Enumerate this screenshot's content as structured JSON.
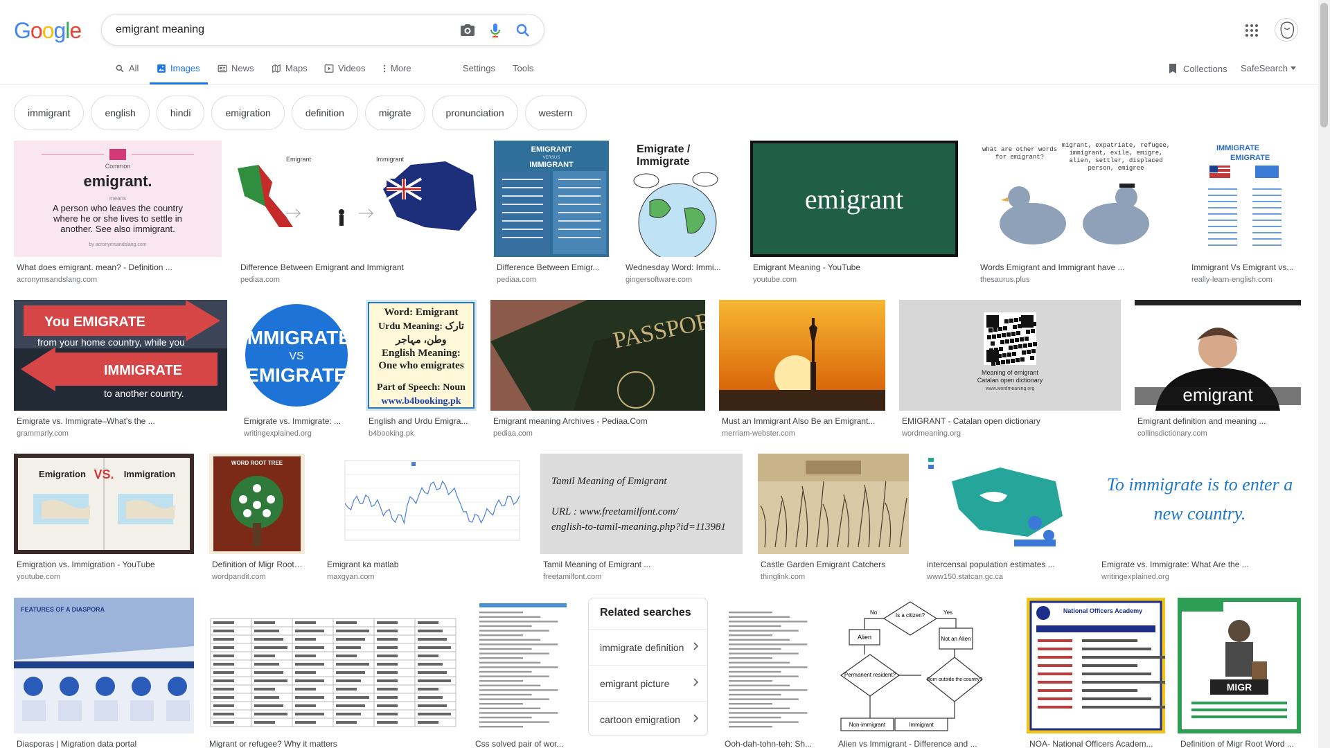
{
  "logo": {
    "letters": [
      "G",
      "o",
      "o",
      "g",
      "l",
      "e"
    ],
    "colors": [
      "#4285F4",
      "#EA4335",
      "#FBBC05",
      "#4285F4",
      "#34A853",
      "#EA4335"
    ]
  },
  "search": {
    "query": "emigrant meaning",
    "placeholder": ""
  },
  "tabs": [
    {
      "label": "All",
      "icon": "search-icon"
    },
    {
      "label": "Images",
      "icon": "image-icon"
    },
    {
      "label": "News",
      "icon": "news-icon"
    },
    {
      "label": "Maps",
      "icon": "map-icon"
    },
    {
      "label": "Videos",
      "icon": "video-icon"
    },
    {
      "label": "More",
      "icon": "more-vert-icon"
    },
    {
      "label": "Settings"
    },
    {
      "label": "Tools"
    }
  ],
  "header_right": {
    "collections": "Collections",
    "safesearch": "SafeSearch"
  },
  "chips": [
    "immigrant",
    "english",
    "hindi",
    "emigration",
    "definition",
    "migrate",
    "pronunciation",
    "western"
  ],
  "results": [
    {
      "title": "What does emigrant. mean? - Definition ...",
      "site": "acronymsandslang.com",
      "thumb": {
        "kind": "definition",
        "label_small": "Common",
        "word": "emigrant.",
        "label_sub": "means",
        "text": "A person who leaves the country where he or she lives to settle in another. See also immigrant.",
        "footer": "by acronymsandslang.com"
      }
    },
    {
      "title": "Difference Between Emigrant and Immigrant",
      "site": "pediaa.com",
      "thumb": {
        "kind": "italy",
        "left": "Emigrant",
        "right": "Immigrant"
      }
    },
    {
      "title": "Difference Between Emigr...",
      "site": "pediaa.com",
      "thumb": {
        "kind": "versus",
        "l1": "EMIGRANT",
        "l2": "VERSUS",
        "l3": "IMMIGRANT"
      }
    },
    {
      "title": "Wednesday Word: Immi...",
      "site": "gingersoftware.com",
      "thumb": {
        "kind": "globe",
        "text": "Emigrate / Immigrate"
      }
    },
    {
      "title": "Emigrant Meaning - YouTube",
      "site": "youtube.com",
      "thumb": {
        "kind": "chalk",
        "text": "emigrant"
      }
    },
    {
      "title": "Words Emigrant and Immigrant have ...",
      "site": "thesaurus.plus",
      "thumb": {
        "kind": "pigeons",
        "q": "what are other words for emigrant?",
        "words": "migrant, expatriate, refugee, immigrant, exile, emigre, alien, settler, displaced person, emigree"
      }
    },
    {
      "title": "Immigrant Vs Emigrant vs...",
      "site": "really-learn-english.com",
      "thumb": {
        "kind": "iv",
        "a": "IMMIGRATE",
        "b": "EMIGRATE"
      }
    },
    {
      "title": "Emigrate vs. Immigrate–What's the ...",
      "site": "grammarly.com",
      "thumb": {
        "kind": "arrows",
        "l1": "You EMIGRATE",
        "l2": "from your home country, while you",
        "l3": "IMMIGRATE",
        "l4": "to another country."
      }
    },
    {
      "title": "Emigrate vs. Immigrate: ...",
      "site": "writingexplained.org",
      "thumb": {
        "kind": "badge",
        "a": "IMMIGRATE",
        "vs": "VS",
        "b": "EMIGRATE"
      }
    },
    {
      "title": "English and Urdu Emigra...",
      "site": "b4booking.pk",
      "thumb": {
        "kind": "urdu",
        "l1": "Word: Emigrant",
        "l2": "Urdu Meaning: تارک",
        "l3": "وطن، مہاجر",
        "l4": "English Meaning: One who emigrates",
        "l5": "Part of Speech: Noun",
        "l6": "www.b4booking.pk"
      }
    },
    {
      "title": "Emigrant meaning Archives - Pediaa.Com",
      "site": "pediaa.com",
      "thumb": {
        "kind": "passport",
        "text": "PASSPORT"
      }
    },
    {
      "title": "Must an Immigrant Also Be an Emigrant...",
      "site": "merriam-webster.com",
      "thumb": {
        "kind": "liberty"
      }
    },
    {
      "title": "EMIGRANT - Catalan open dictionary",
      "site": "wordmeaning.org",
      "thumb": {
        "kind": "qr",
        "l1": "Meaning of emigrant",
        "l2": "Catalan open dictionary",
        "l3": "www.wordmeaning.org"
      }
    },
    {
      "title": "Emigrant definition and meaning ...",
      "site": "collinsdictionary.com",
      "thumb": {
        "kind": "man",
        "text": "emigrant"
      }
    },
    {
      "title": "Emigration vs. Immigration - YouTube",
      "site": "youtube.com",
      "thumb": {
        "kind": "book",
        "a": "Emigration",
        "vs": "VS.",
        "b": "Immigration"
      }
    },
    {
      "title": "Definition of Migr Root ...",
      "site": "wordpandit.com",
      "thumb": {
        "kind": "tree",
        "text": "WORD ROOT TREE"
      }
    },
    {
      "title": "Emigrant ka matlab",
      "site": "maxgyan.com",
      "thumb": {
        "kind": "graph"
      }
    },
    {
      "title": "Tamil Meaning of Emigrant ...",
      "site": "freetamilfont.com",
      "thumb": {
        "kind": "tamil",
        "l1": "Tamil Meaning of Emigrant",
        "l2": "URL : www.freetamilfont.com/",
        "l3": "english-to-tamil-meaning.php?id=113981"
      }
    },
    {
      "title": "Castle Garden Emigrant Catchers",
      "site": "thinglink.com",
      "thumb": {
        "kind": "sketch"
      }
    },
    {
      "title": "intercensal population estimates ...",
      "site": "www150.statcan.gc.ca",
      "thumb": {
        "kind": "canada"
      }
    },
    {
      "title": "Emigrate vs. Immigrate: What Are the ...",
      "site": "writingexplained.org",
      "thumb": {
        "kind": "quote",
        "text": "To immigrate is to enter a new country."
      }
    },
    {
      "title": "Diasporas | Migration data portal",
      "site": "",
      "thumb": {
        "kind": "diaspora",
        "text": "FEATURES OF A DIASPORA"
      }
    },
    {
      "title": "Migrant or refugee? Why it matters",
      "site": "",
      "thumb": {
        "kind": "wordtable"
      }
    },
    {
      "title": "Css solved pair of wor...",
      "site": "",
      "thumb": {
        "kind": "doc"
      }
    },
    {
      "title": "Ooh-dah-tohn-teh: Sh...",
      "site": "",
      "thumb": {
        "kind": "doc2"
      }
    },
    {
      "title": "Alien vs Immigrant - Difference and ...",
      "site": "",
      "thumb": {
        "kind": "flow",
        "q": "Is a citizen?",
        "yes": "Yes",
        "no": "No",
        "alien": "Alien",
        "notalien": "Not an Alien",
        "perm": "Permanent resident?",
        "born": "Born outside the country?",
        "nonimm": "Non-immigrant",
        "imm": "Immigrant"
      }
    },
    {
      "title": "NOA- National Officers Academ...",
      "site": "",
      "thumb": {
        "kind": "noa",
        "text": "National Officers Academy"
      }
    },
    {
      "title": "Definition of Migr Root Word ...",
      "site": "",
      "thumb": {
        "kind": "migr",
        "text": "MIGR"
      }
    }
  ],
  "related": {
    "title": "Related searches",
    "items": [
      "immigrate definition",
      "emigrant picture",
      "cartoon emigration"
    ]
  }
}
